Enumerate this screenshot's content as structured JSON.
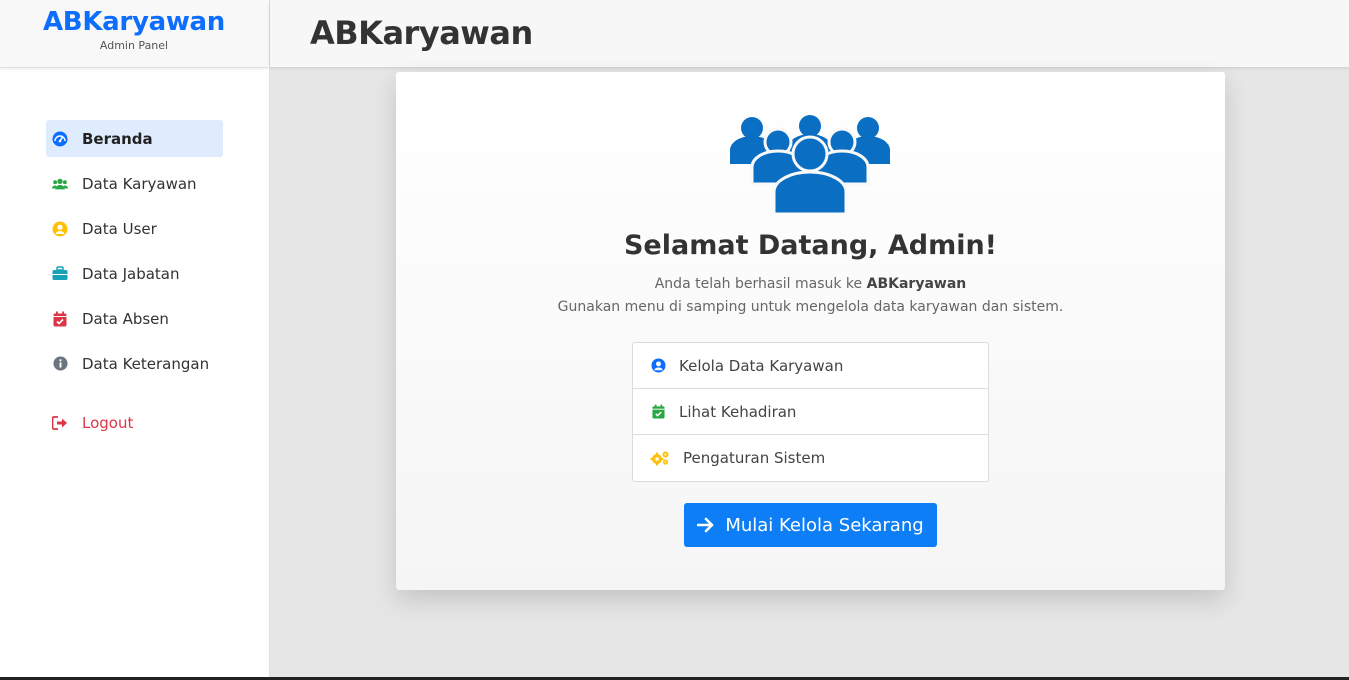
{
  "brand": {
    "name": "ABKaryawan",
    "subtitle": "Admin Panel"
  },
  "header": {
    "title": "ABKaryawan"
  },
  "sidebar": {
    "items": [
      {
        "label": "Beranda",
        "icon": "dashboard-icon",
        "active": true
      },
      {
        "label": "Data Karyawan",
        "icon": "users-icon"
      },
      {
        "label": "Data User",
        "icon": "user-circle-icon"
      },
      {
        "label": "Data Jabatan",
        "icon": "briefcase-icon"
      },
      {
        "label": "Data Absen",
        "icon": "calendar-check-icon"
      },
      {
        "label": "Data Keterangan",
        "icon": "info-circle-icon"
      }
    ],
    "logout_label": "Logout"
  },
  "main": {
    "welcome": "Selamat Datang, Admin!",
    "intro_prefix": "Anda telah berhasil masuk ke",
    "intro_brand": "ABKaryawan",
    "intro_line2": "Gunakan menu di samping untuk mengelola data karyawan dan sistem.",
    "features": [
      {
        "label": "Kelola Data Karyawan",
        "icon": "user-circle-icon"
      },
      {
        "label": "Lihat Kehadiran",
        "icon": "calendar-check-icon"
      },
      {
        "label": "Pengaturan Sistem",
        "icon": "cogs-icon"
      }
    ],
    "cta_label": "Mulai Kelola Sekarang"
  },
  "colors": {
    "primary": "#0d6efd",
    "success": "#28a745",
    "warning": "#ffc107",
    "info": "#17a2b8",
    "danger": "#dc3545",
    "hero_icon": "#0d6efd"
  }
}
